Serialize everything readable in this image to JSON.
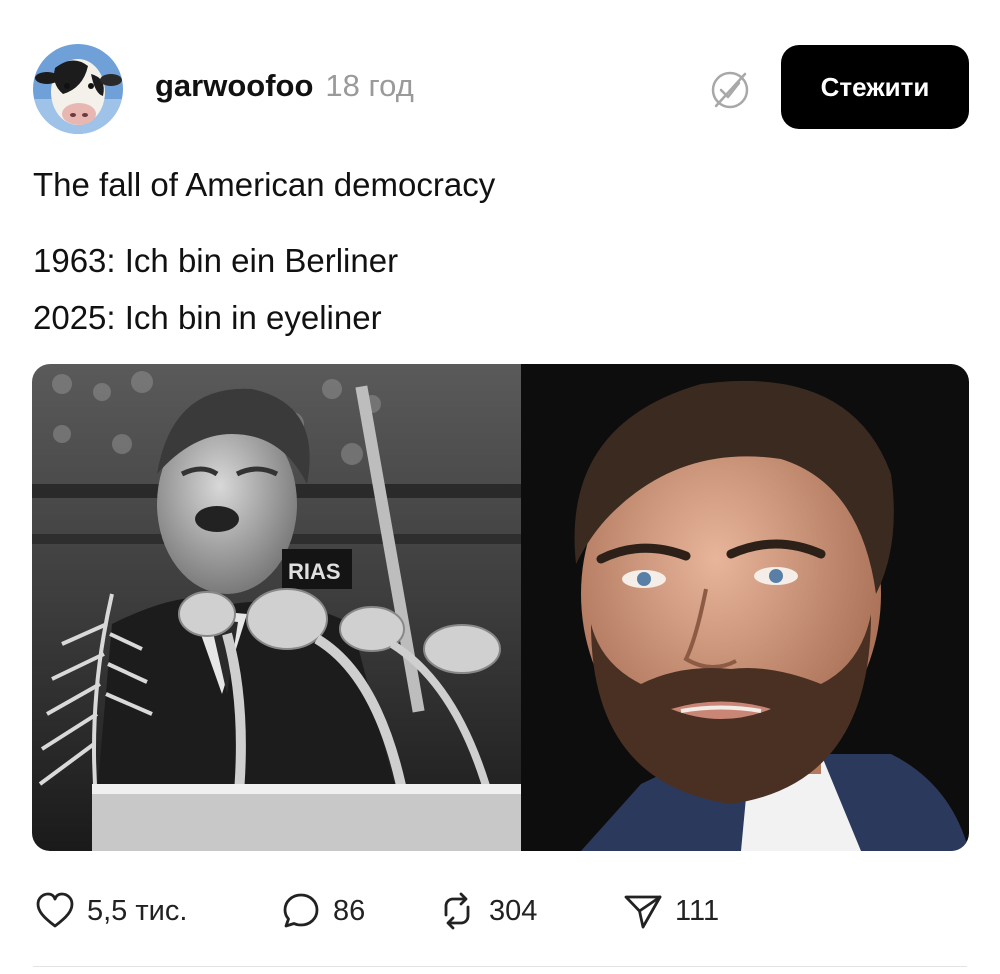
{
  "post": {
    "username": "garwoofoo",
    "time": "18 год",
    "follow_label": "Стежити",
    "text": [
      "The fall of American democracy",
      "1963: Ich bin ein Berliner",
      "2025: Ich bin in eyeliner"
    ],
    "media": {
      "left_panel_sign": "RIAS",
      "icons": [
        "avatar-cow",
        "verified-slash-icon"
      ]
    },
    "actions": {
      "likes": "5,5 тис.",
      "replies": "86",
      "reposts": "304",
      "shares": "111"
    },
    "icons": {
      "like": "heart-icon",
      "reply": "speech-bubble-icon",
      "repost": "repost-arrows-icon",
      "share": "paper-plane-icon"
    },
    "colors": {
      "follow_bg": "#000000",
      "follow_text": "#ffffff",
      "time_text": "#9a9a9a"
    }
  }
}
